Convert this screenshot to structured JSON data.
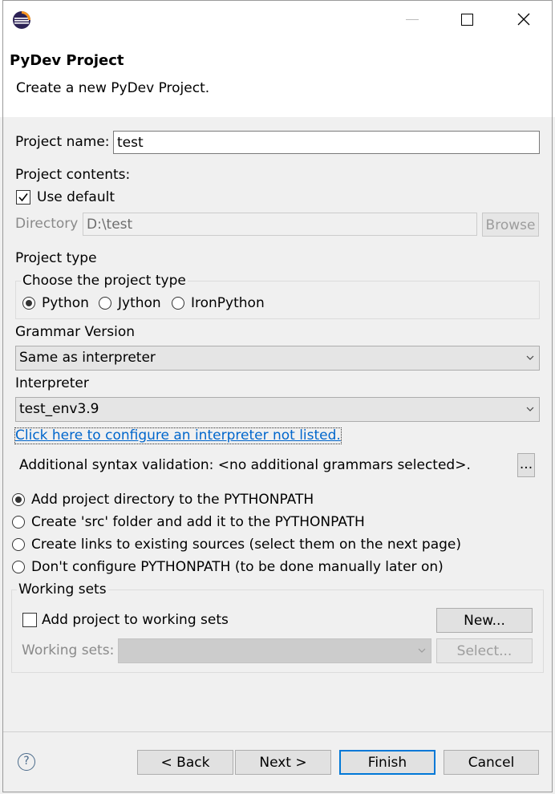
{
  "window": {
    "title": "PyDev Project",
    "subtitle": "Create a new PyDev Project."
  },
  "form": {
    "project_name_label": "Project name:",
    "project_name_value": "test",
    "project_contents_label": "Project contents:",
    "use_default_label": "Use default",
    "use_default_checked": true,
    "directory_label": "Directory",
    "directory_value": "D:\\test",
    "browse_label": "Browse",
    "project_type_label": "Project type",
    "choose_type_label": "Choose the project type",
    "project_types": [
      "Python",
      "Jython",
      "IronPython"
    ],
    "selected_project_type": "Python",
    "grammar_label": "Grammar Version",
    "grammar_value": "Same as interpreter",
    "interpreter_label": "Interpreter",
    "interpreter_value": "test_env3.9",
    "configure_link": "Click here to configure an interpreter not listed.",
    "syntax_validation_text": "Additional syntax validation: <no additional grammars selected>.",
    "ellipsis_label": "...",
    "pythonpath_options": [
      "Add project directory to the PYTHONPATH",
      "Create 'src' folder and add it to the PYTHONPATH",
      "Create links to existing sources (select them on the next page)",
      "Don't configure PYTHONPATH (to be done manually later on)"
    ],
    "selected_pythonpath_option": "Add project directory to the PYTHONPATH",
    "working_sets_label": "Working sets",
    "add_to_working_sets_label": "Add project to working sets",
    "add_to_working_sets_checked": false,
    "new_button_label": "New...",
    "working_sets_field_label": "Working sets:",
    "working_sets_value": "",
    "select_button_label": "Select..."
  },
  "footer": {
    "help_symbol": "?",
    "back_label": "< Back",
    "next_label": "Next >",
    "finish_label": "Finish",
    "cancel_label": "Cancel"
  },
  "colors": {
    "accent": "#0078d7",
    "link": "#0066cc",
    "panel_bg": "#f0f0f0"
  },
  "icons": {
    "app": "eclipse-icon",
    "minimize": "minimize-icon",
    "maximize": "maximize-icon",
    "close": "close-icon",
    "help": "help-icon",
    "dropdown": "chevron-down-icon"
  }
}
